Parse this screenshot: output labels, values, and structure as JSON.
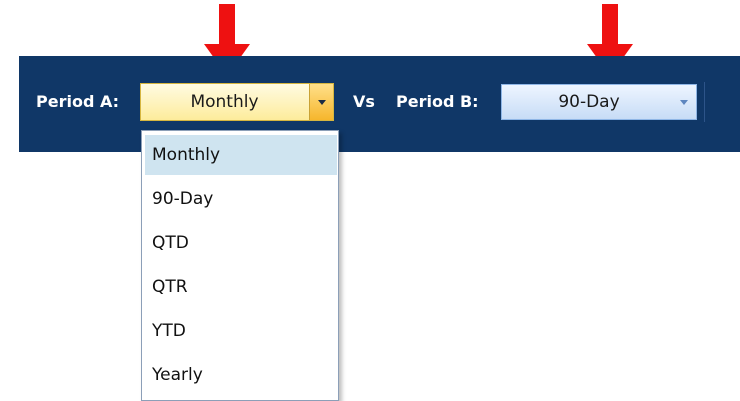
{
  "toolbar": {
    "period_a_label": "Period A:",
    "vs_label": "Vs",
    "period_b_label": "Period B:",
    "background_color": "#103767"
  },
  "period_a": {
    "selected": "Monthly",
    "options": [
      "Monthly",
      "90-Day",
      "QTD",
      "QTR",
      "YTD",
      "Yearly"
    ],
    "highlight_color": "#cfe4f0"
  },
  "period_b": {
    "selected": "90-Day"
  },
  "annotations": {
    "arrow_color": "#ee1111",
    "arrow_icon": "arrow-down-icon"
  }
}
